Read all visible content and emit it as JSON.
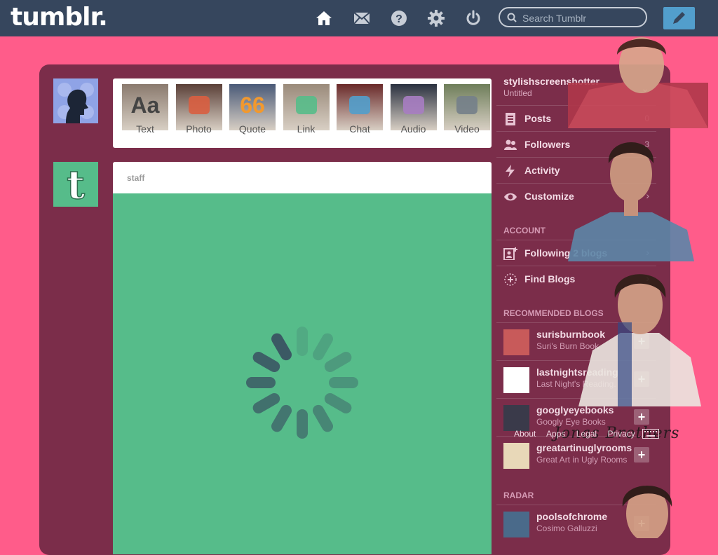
{
  "header": {
    "logo": "tumblr.",
    "search_placeholder": "Search Tumblr",
    "nav_icons": [
      "home-icon",
      "mail-icon",
      "help-icon",
      "gear-icon",
      "power-icon"
    ],
    "compose_icon": "pencil-icon"
  },
  "post_types": [
    {
      "label": "Text",
      "icon": "text-icon",
      "glyph": "Aa",
      "color": "#444444"
    },
    {
      "label": "Photo",
      "icon": "camera-icon",
      "glyph": "",
      "color": "#d95e40"
    },
    {
      "label": "Quote",
      "icon": "quote-icon",
      "glyph": "66",
      "color": "#f2992e"
    },
    {
      "label": "Link",
      "icon": "link-icon",
      "glyph": "",
      "color": "#56bc8a"
    },
    {
      "label": "Chat",
      "icon": "chat-icon",
      "glyph": "",
      "color": "#529ecc"
    },
    {
      "label": "Audio",
      "icon": "headphones-icon",
      "glyph": "",
      "color": "#a77dc2"
    },
    {
      "label": "Video",
      "icon": "video-camera-icon",
      "glyph": "",
      "color": "#748089"
    }
  ],
  "post": {
    "author": "staff"
  },
  "sidebar": {
    "blog_name": "stylishscreenshotter",
    "blog_title": "Untitled",
    "items": [
      {
        "label": "Posts",
        "count": "0",
        "icon": "posts-icon"
      },
      {
        "label": "Followers",
        "count": "3",
        "icon": "followers-icon"
      },
      {
        "label": "Activity",
        "count": "",
        "icon": "lightning-icon"
      },
      {
        "label": "Customize",
        "count": "",
        "icon": "eye-icon"
      }
    ],
    "account_heading": "ACCOUNT",
    "account_items": [
      {
        "label": "Following 2 blogs",
        "icon": "following-icon"
      },
      {
        "label": "Find Blogs",
        "icon": "find-blogs-icon"
      }
    ],
    "recommended_heading": "RECOMMENDED BLOGS",
    "recommended": [
      {
        "name": "surisburnbook",
        "title": "Suri's Burn Book"
      },
      {
        "name": "lastnightsreading",
        "title": "Last Night's Reading."
      },
      {
        "name": "googlyeyebooks",
        "title": "Googly Eye Books"
      },
      {
        "name": "greatartinuglyrooms",
        "title": "Great Art in Ugly Rooms"
      }
    ],
    "radar_heading": "RADAR",
    "radar": [
      {
        "name": "poolsofchrome",
        "title": "Cosimo Galluzzi"
      }
    ]
  },
  "footer": {
    "links": [
      "About",
      "Apps",
      "Legal",
      "Privacy"
    ]
  },
  "overlay_text": "Jonas Brothers",
  "colors": {
    "background": "#ff5c8a",
    "topbar": "#36465d",
    "dashboard": "#7b2d4a",
    "post_body": "#56bc8a",
    "compose": "#529ecc"
  }
}
